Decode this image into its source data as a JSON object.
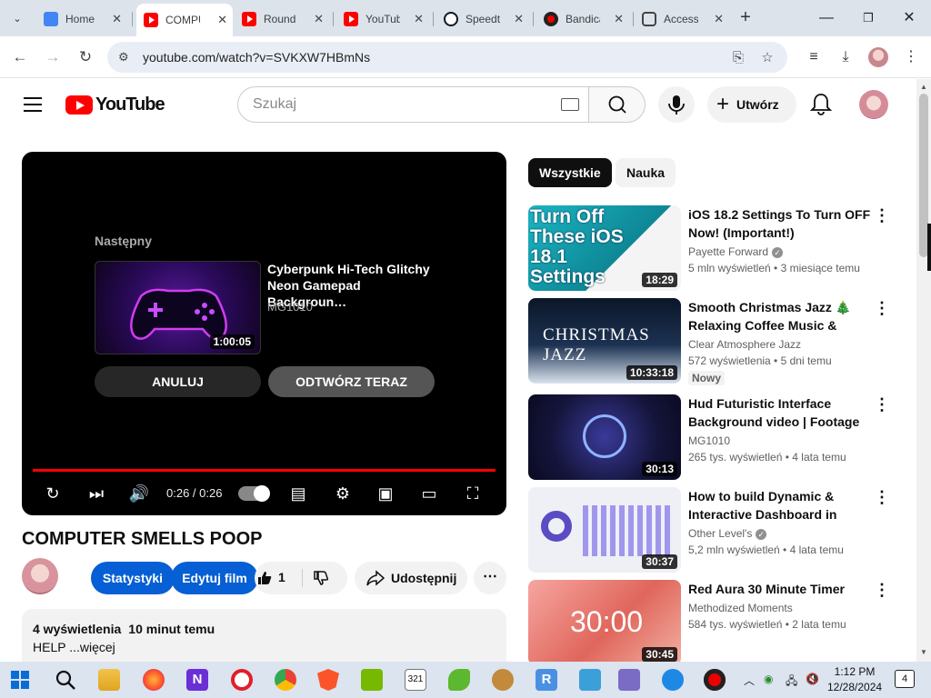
{
  "browser": {
    "tabs": [
      {
        "label": "Home",
        "icon": "home-favicon"
      },
      {
        "label": "COMPUTER SMELLS POOP",
        "icon": "youtube-favicon"
      },
      {
        "label": "Roundup",
        "icon": "youtube-favicon"
      },
      {
        "label": "YouTube",
        "icon": "youtube-favicon"
      },
      {
        "label": "Speedtest",
        "icon": "speedtest-favicon"
      },
      {
        "label": "Bandicam",
        "icon": "bandicam-favicon"
      },
      {
        "label": "Access",
        "icon": "access-favicon"
      }
    ],
    "url": "youtube.com/watch?v=SVKXW7HBmNs"
  },
  "yt_header": {
    "logo_text": "YouTube",
    "search_placeholder": "Szukaj",
    "create_label": "Utwórz"
  },
  "player": {
    "up_next_label": "Następny",
    "up_next_title": "Cyberpunk Hi-Tech Glitchy Neon Gamepad Backgroun…",
    "up_next_channel": "MG1010",
    "up_next_duration": "1:00:05",
    "cancel_label": "ANULUJ",
    "play_now_label": "ODTWÓRZ TERAZ",
    "timecode": "0:26 / 0:26",
    "progress": 1.0
  },
  "video": {
    "title": "COMPUTER SMELLS POOP",
    "stats_button": "Statystyki",
    "edit_button": "Edytuj film",
    "like_count": "1",
    "share_label": "Udostępnij",
    "views": "4 wyświetlenia",
    "uploaded": "10 minut temu",
    "description": "HELP ...więcej"
  },
  "sidebar": {
    "chips": [
      "Wszystkie",
      "Nauka"
    ],
    "recommendations": [
      {
        "title": "iOS 18.2 Settings To Turn OFF Now! (Important!)",
        "channel": "Payette Forward",
        "verified": true,
        "views": "5 mln wyświetleń",
        "age": "3 miesiące temu",
        "duration": "18:29",
        "thumb_text": "Turn Off These iOS 18.1 Settings",
        "badge": ""
      },
      {
        "title": "Smooth Christmas Jazz 🎄 Relaxing Coffee Music & Boss…",
        "channel": "Clear Atmosphere Jazz",
        "verified": false,
        "views": "572 wyświetlenia",
        "age": "5 dni temu",
        "duration": "10:33:18",
        "thumb_text": "CHRISTMAS JAZZ",
        "badge": "Nowy"
      },
      {
        "title": "Hud Futuristic Interface Background video | Footage |…",
        "channel": "MG1010",
        "verified": false,
        "views": "265 tys. wyświetleń",
        "age": "4 lata temu",
        "duration": "30:13",
        "thumb_text": "",
        "badge": ""
      },
      {
        "title": "How to build Dynamic & Interactive Dashboard in EXCE…",
        "channel": "Other Level's",
        "verified": true,
        "views": "5,2 mln wyświetleń",
        "age": "4 lata temu",
        "duration": "30:37",
        "thumb_text": "",
        "badge": ""
      },
      {
        "title": "Red Aura 30 Minute Timer",
        "channel": "Methodized Moments",
        "verified": false,
        "views": "584 tys. wyświetleń",
        "age": "2 lata temu",
        "duration": "30:45",
        "thumb_text": "30:00",
        "badge": ""
      }
    ]
  },
  "taskbar": {
    "time": "1:12 PM",
    "date": "12/28/2024",
    "notification_count": "4"
  },
  "colors": {
    "youtube_red": "#ff0000",
    "primary_blue": "#065fd4",
    "chip_active": "#0f0f0f",
    "tab_strip": "#dde3ea"
  }
}
